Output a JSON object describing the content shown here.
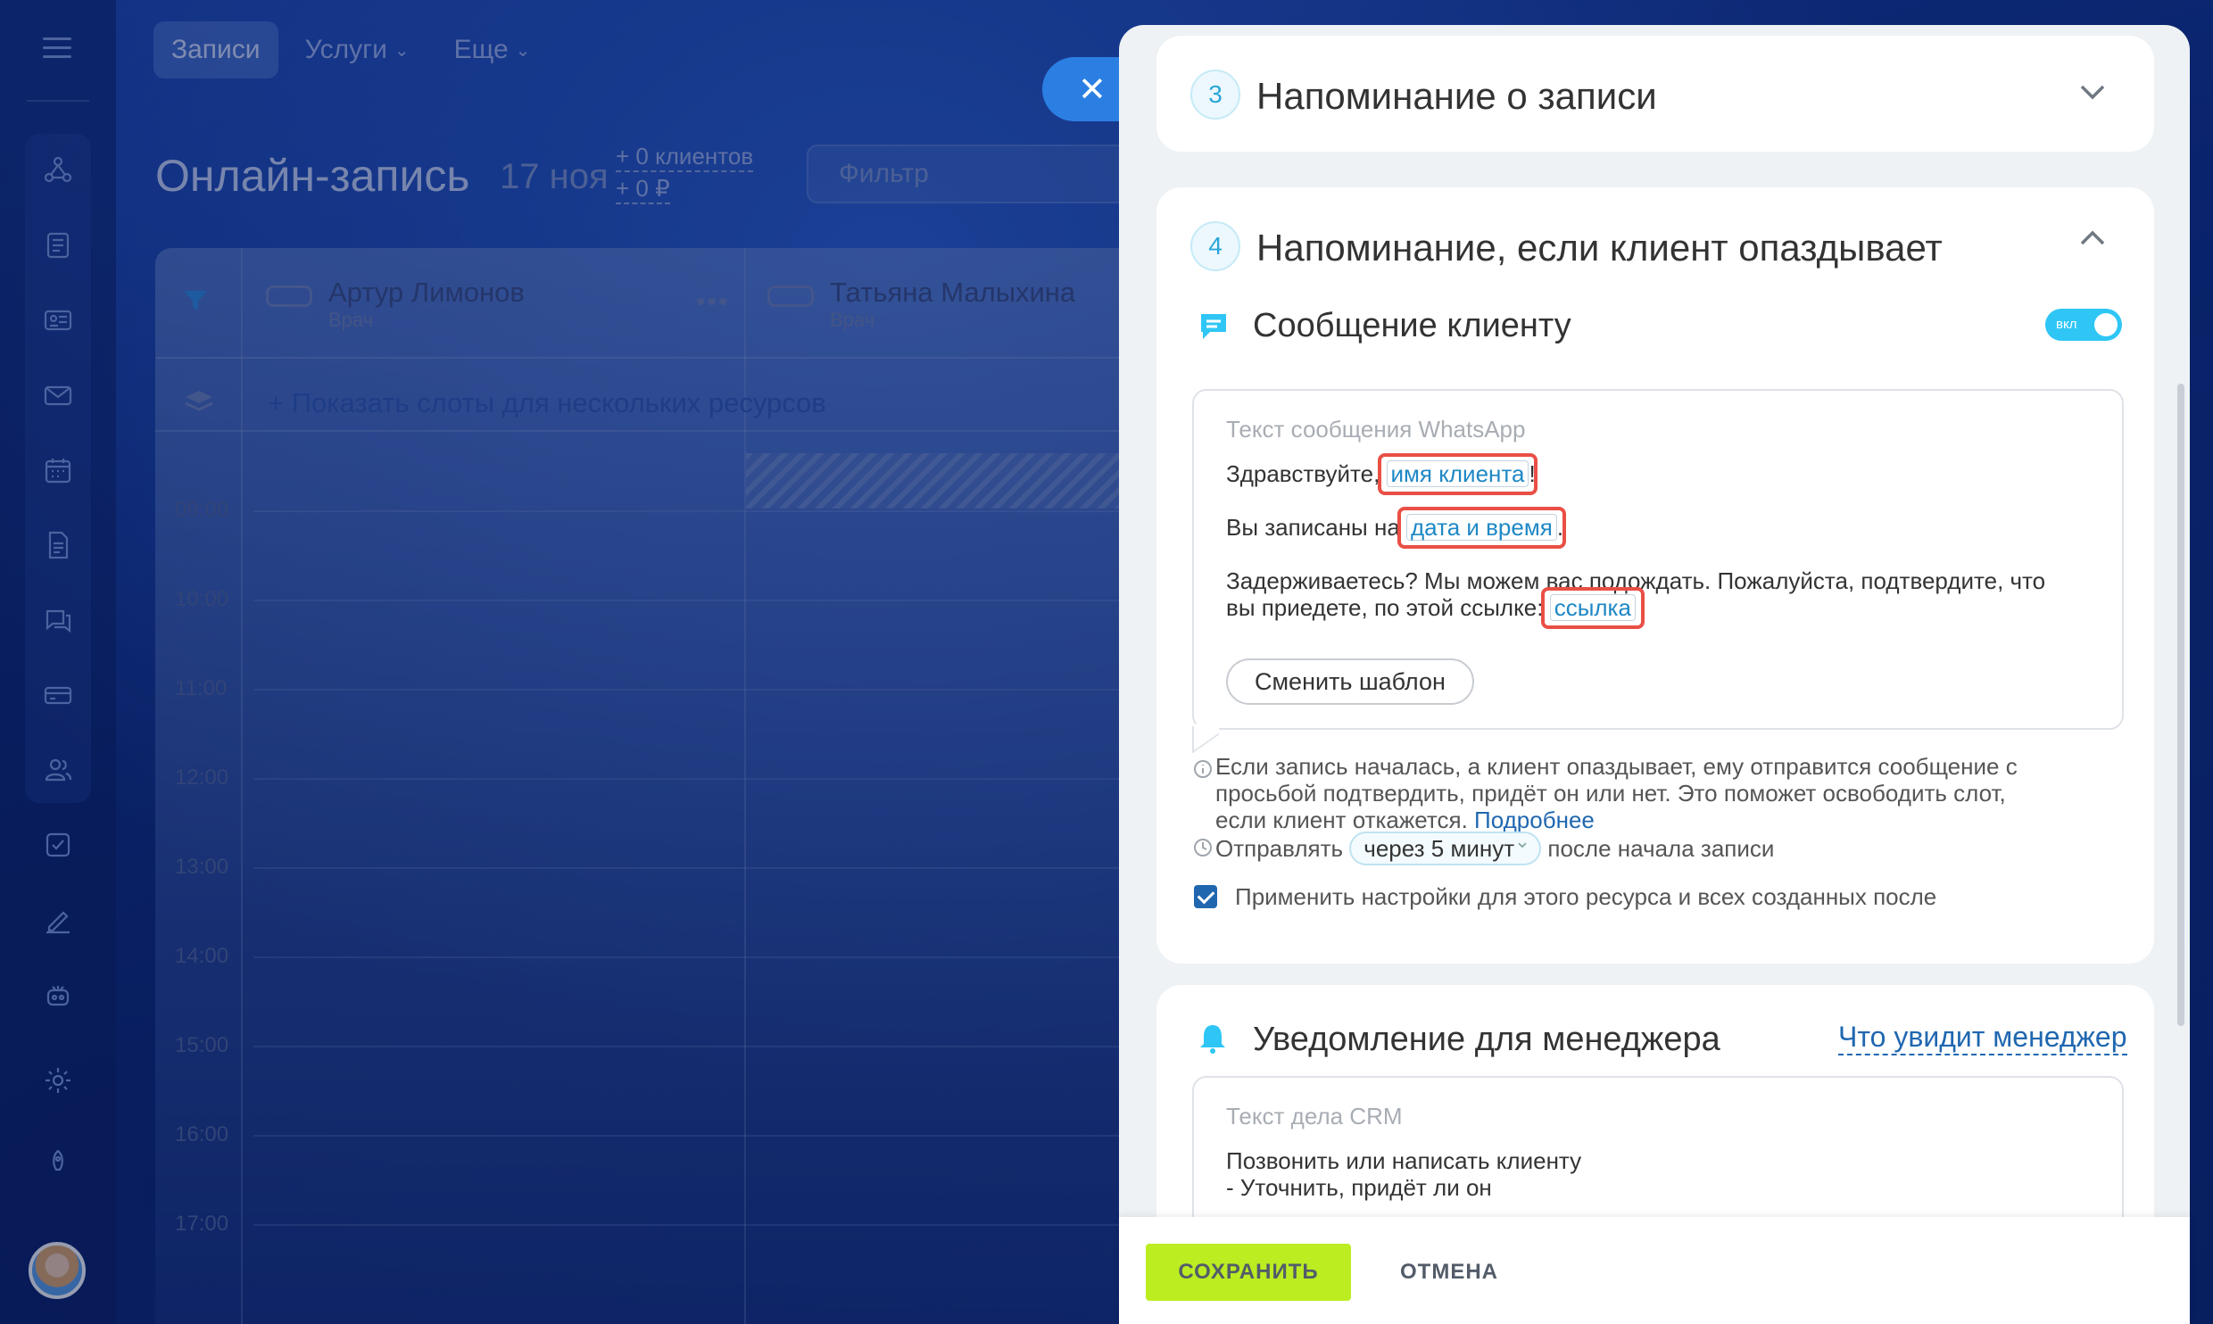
{
  "nav": {
    "tabs": [
      {
        "label": "Записи"
      },
      {
        "label": "Услуги"
      },
      {
        "label": "Еще"
      }
    ]
  },
  "header": {
    "title": "Онлайн-запись",
    "date": "17 ноя",
    "clients_counter": "+ 0 клиентов",
    "money_counter": "+ 0 ₽",
    "filter_placeholder": "Фильтр"
  },
  "calendar": {
    "resources": [
      {
        "name": "Артур Лимонов",
        "role": "Врач"
      },
      {
        "name": "Татьяна Малыхина",
        "role": "Врач"
      }
    ],
    "show_slots_link": "+ Показать слоты для нескольких ресурсов",
    "times": [
      "09:00",
      "10:00",
      "11:00",
      "12:00",
      "13:00",
      "14:00",
      "15:00",
      "16:00",
      "17:00"
    ]
  },
  "panel": {
    "step3": {
      "number": "3",
      "title": "Напоминание о записи"
    },
    "step4": {
      "number": "4",
      "title": "Напоминание, если клиент опаздывает"
    },
    "client_message": {
      "title": "Сообщение клиенту",
      "toggle_label": "вкл",
      "box_label": "Текст сообщения WhatsApp",
      "line1_text": "Здравствуйте, ",
      "line1_tag": "имя клиента",
      "line1_end": "!",
      "line2_text": "Вы записаны на ",
      "line2_tag": "дата и время",
      "line2_end": ".",
      "line3": "Задерживаетесь? Мы можем вас подождать. Пожалуйста, подтвердите, что",
      "line4_text": "вы приедете, по этой ссылке: ",
      "line4_tag": "ссылка",
      "change_template": "Сменить шаблон"
    },
    "info": {
      "line1": "Если запись началась, а клиент опаздывает, ему отправится сообщение с",
      "line2": "просьбой подтвердить, придёт он или нет. Это поможет освободить слот,",
      "line3": "если клиент откажется. ",
      "more_link": "Подробнее"
    },
    "send": {
      "prefix": "Отправлять",
      "value": "через 5 минут",
      "suffix": "после начала записи"
    },
    "apply_label": "Применить настройки для этого ресурса и всех созданных после",
    "manager": {
      "title": "Уведомление для менеджера",
      "preview_link": "Что увидит менеджер",
      "box_label": "Текст дела CRM",
      "line1": "Позвонить или написать клиенту",
      "line2": "- Уточнить, придёт ли он"
    }
  },
  "footer": {
    "save": "СОХРАНИТЬ",
    "cancel": "ОТМЕНА"
  },
  "colors": {
    "accent_green": "#bbed21",
    "accent_blue": "#2fc6f6",
    "highlight_red": "#e94f45",
    "link_blue": "#2067b0"
  }
}
